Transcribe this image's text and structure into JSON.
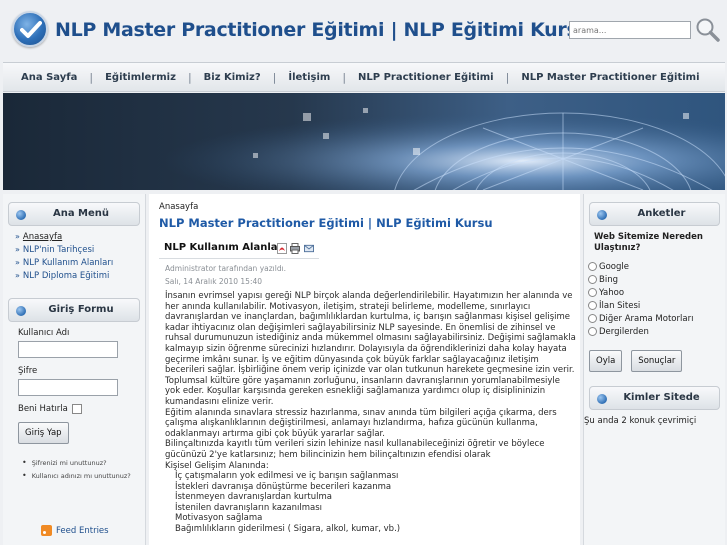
{
  "header": {
    "title": "NLP Master Practitioner Eğitimi | NLP Eğitimi Kursu",
    "search_placeholder": "arama...",
    "search_icon": "search-icon"
  },
  "nav": {
    "items": [
      "Ana Sayfa",
      "Eğitimlermiz",
      "Biz Kimiz?",
      "İletişim",
      "NLP Practitioner Eğitimi",
      "NLP Master Practitioner Eğitimi"
    ]
  },
  "left": {
    "main_menu": {
      "title": "Ana Menü",
      "items": [
        "Anasayfa",
        "NLP'nin Tarihçesi",
        "NLP Kullanım Alanları",
        "NLP Diploma Eğitimi"
      ]
    },
    "login": {
      "title": "Giriş Formu",
      "username_label": "Kullanıcı Adı",
      "password_label": "Şifre",
      "remember_label": "Beni Hatırla",
      "submit_label": "Giriş Yap",
      "forgot_password": "Şifrenizi mi unuttunuz?",
      "forgot_username": "Kullanıcı adınızı mı unuttunuz?"
    },
    "feed_label": "Feed Entries"
  },
  "main": {
    "breadcrumb": "Anasayfa",
    "page_title": "NLP Master Practitioner Eğitimi | NLP Eğitimi Kursu",
    "article_title": "NLP Kullanım Alanları",
    "author": "Administrator tarafından yazıldı.",
    "date": "Salı, 14 Aralık 2010 15:40",
    "paragraphs": [
      "İnsanın evrimsel yapısı gereği NLP birçok alanda değerlendirilebilir.  Hayatımızın her alanında ve her anında kullanılabilir. Motivasyon, iletişim, strateji belirleme, modelleme, sınırlayıcı davranışlardan ve inançlardan, bağımlılıklardan kurtulma, iç barışın sağlanması kişisel gelişime kadar ihtiyacınız olan değişimleri sağlayabilirsiniz NLP sayesinde. En önemlisi de zihinsel ve ruhsal durumunuzun istediğiniz anda mükemmel olmasını sağlayabilirsiniz. Değişimi sağlamakla kalmayıp sizin öğrenme sürecinizi hızlandırır. Dolayısıyla da öğrendiklerinizi daha kolay hayata geçirme imkânı sunar. İş ve eğitim dünyasında çok büyük farklar sağlayacağınız iletişim becerileri sağlar. İşbirliğine önem verip içinizde var olan tutkunun harekete geçmesine izin verir. Toplumsal kültüre göre yaşamanın zorluğunu, insanların davranışlarının yorumlanabilmesiyle yok eder. Koşullar karşısında gereken esnekliği sağlamanıza yardımcı olup iç disiplininizin kumandasını elinize verir.",
      "Eğitim alanında sınavlara stressiz hazırlanma, sınav anında tüm bilgileri açığa çıkarma, ders çalışma alışkanlıklarının değiştirilmesi, anlamayı hızlandırma, hafıza gücünün kullanma, odaklanmayı artırma gibi çok büyük yararlar sağlar.",
      "Bilinçaltınızda kayıtlı tüm verileri sizin lehinize nasıl kullanabileceğinizi öğretir ve böylece gücünüzü 2'ye katlarsınız; hem bilincinizin hem bilinçaltınızın efendisi olarak",
      "Kişisel Gelişim  Alanında:"
    ],
    "list_items": [
      "İç çatışmaların yok edilmesi ve iç barışın sağlanması",
      "İstekleri davranışa dönüştürme becerileri kazanma",
      "İstenmeyen davranışlardan kurtulma",
      "İstenilen davranışların kazanılması",
      "Motivasyon sağlama",
      "Bağımlılıkların giderilmesi ( Sigara, alkol, kumar, vb.)"
    ]
  },
  "right": {
    "poll": {
      "title": "Anketler",
      "question": "Web Sitemize Nereden Ulaştınız?",
      "options": [
        "Google",
        "Bing",
        "Yahoo",
        "İlan Sitesi",
        "Diğer Arama Motorları",
        "Dergilerden"
      ],
      "vote_label": "Oyla",
      "results_label": "Sonuçlar"
    },
    "online": {
      "title": "Kimler Sitede",
      "text": "Şu anda 2 konuk çevrimiçi"
    }
  }
}
